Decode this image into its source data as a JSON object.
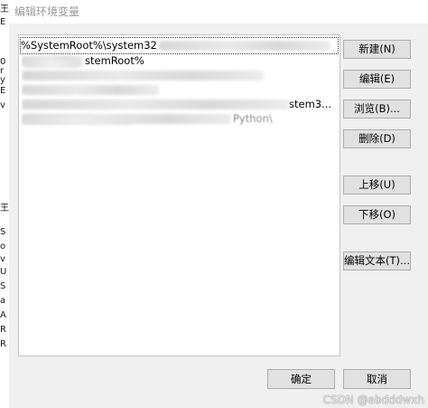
{
  "window": {
    "title": "编辑环境变量"
  },
  "background_fragments": [
    "王",
    "E",
    "0",
    "r",
    "y",
    "E",
    "v",
    "王",
    "S",
    "o",
    "v",
    "U",
    "S",
    "a",
    "A",
    "R",
    "R"
  ],
  "path_list": {
    "items": [
      {
        "visible_text": "%SystemRoot%\\system32",
        "selected": true
      },
      {
        "visible_text": "stemRoot%",
        "selected": false
      },
      {
        "visible_text": "",
        "selected": false
      },
      {
        "visible_text": "",
        "selected": false
      },
      {
        "visible_text": "stem3...",
        "selected": false
      },
      {
        "visible_text": "Python\\",
        "selected": false
      }
    ]
  },
  "buttons": {
    "new": "新建(N)",
    "edit": "编辑(E)",
    "browse": "浏览(B)...",
    "delete": "删除(D)",
    "move_up": "上移(U)",
    "move_down": "下移(O)",
    "edit_text": "编辑文本(T)..."
  },
  "footer": {
    "ok": "确定",
    "cancel": "取消"
  },
  "watermark": "CSDN @abdddwxh"
}
